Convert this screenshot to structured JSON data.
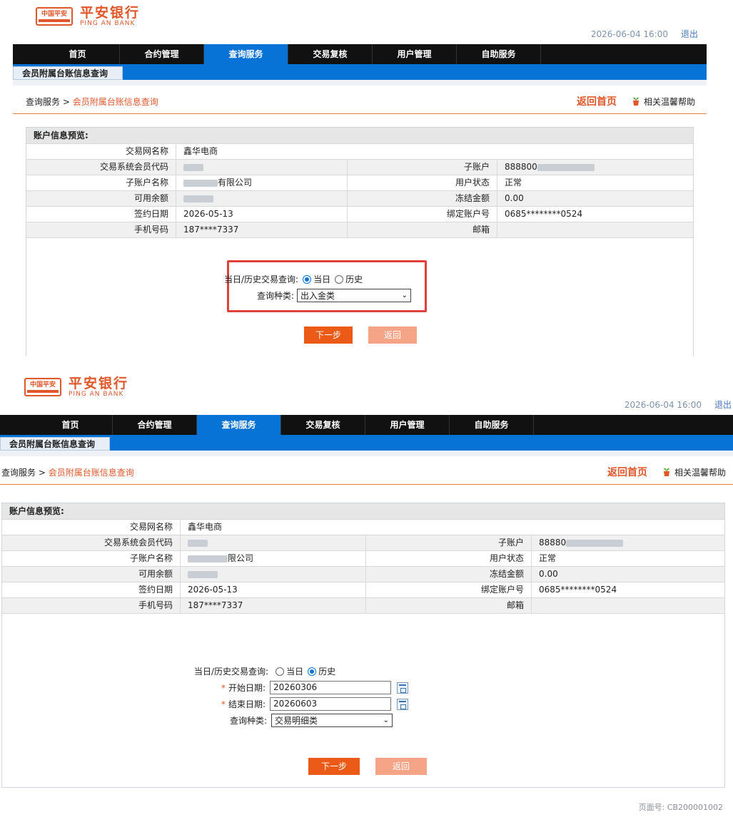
{
  "brand": {
    "cn": "平安银行",
    "en": "PING AN BANK",
    "badge": "中国平安"
  },
  "header": {
    "datetime": "2026-06-04  16:00",
    "logout": "退出"
  },
  "nav": [
    "首页",
    "合约管理",
    "查询服务",
    "交易复核",
    "用户管理",
    "自助服务"
  ],
  "active_nav": "查询服务",
  "subtab": "会员附属台账信息查询",
  "breadcrumb": {
    "root": "查询服务",
    "sep": " > ",
    "current": "会员附属台账信息查询"
  },
  "links": {
    "home": "返回首页",
    "help": "相关温馨帮助"
  },
  "account": {
    "title": "账户信息预览:",
    "labels": {
      "net_name": "交易网名称",
      "member_code": "交易系统会员代码",
      "sub_account": "子账户",
      "sub_name": "子账户名称",
      "user_status": "用户状态",
      "balance": "可用余额",
      "frozen": "冻结金额",
      "sign_date": "签约日期",
      "bind_account": "绑定账户号",
      "phone": "手机号码",
      "email": "邮箱"
    },
    "values1": {
      "net_name": "鑫华电商",
      "sub_account": "888800",
      "sub_name_suffix": "有限公司",
      "user_status": "正常",
      "frozen": "0.00",
      "sign_date": "2026-05-13",
      "bind_account": "0685********0524",
      "phone": "187****7337",
      "email": ""
    },
    "values2": {
      "net_name": "鑫华电商",
      "sub_account": "88880",
      "sub_name_suffix": "限公司",
      "user_status": "正常",
      "frozen": "0.00",
      "sign_date": "2026-05-13",
      "bind_account": "0685********0524",
      "phone": "187****7337",
      "email": ""
    }
  },
  "form1": {
    "query_label": "当日/历史交易查询:",
    "opt_today": "当日",
    "opt_history": "历史",
    "type_label": "查询种类:",
    "type_value": "出入金类"
  },
  "form2": {
    "query_label": "当日/历史交易查询:",
    "opt_today": "当日",
    "opt_history": "历史",
    "start_label": "开始日期:",
    "start_value": "20260306",
    "end_label": "结束日期:",
    "end_value": "20260603",
    "type_label": "查询种类:",
    "type_value": "交易明细类"
  },
  "buttons": {
    "next": "下一步",
    "back": "返回"
  },
  "footer": "页面号: CB200001002",
  "colors": {
    "brand_orange": "#e2572a",
    "nav_blue": "#0873d6",
    "highlight_red": "#e0413f"
  }
}
